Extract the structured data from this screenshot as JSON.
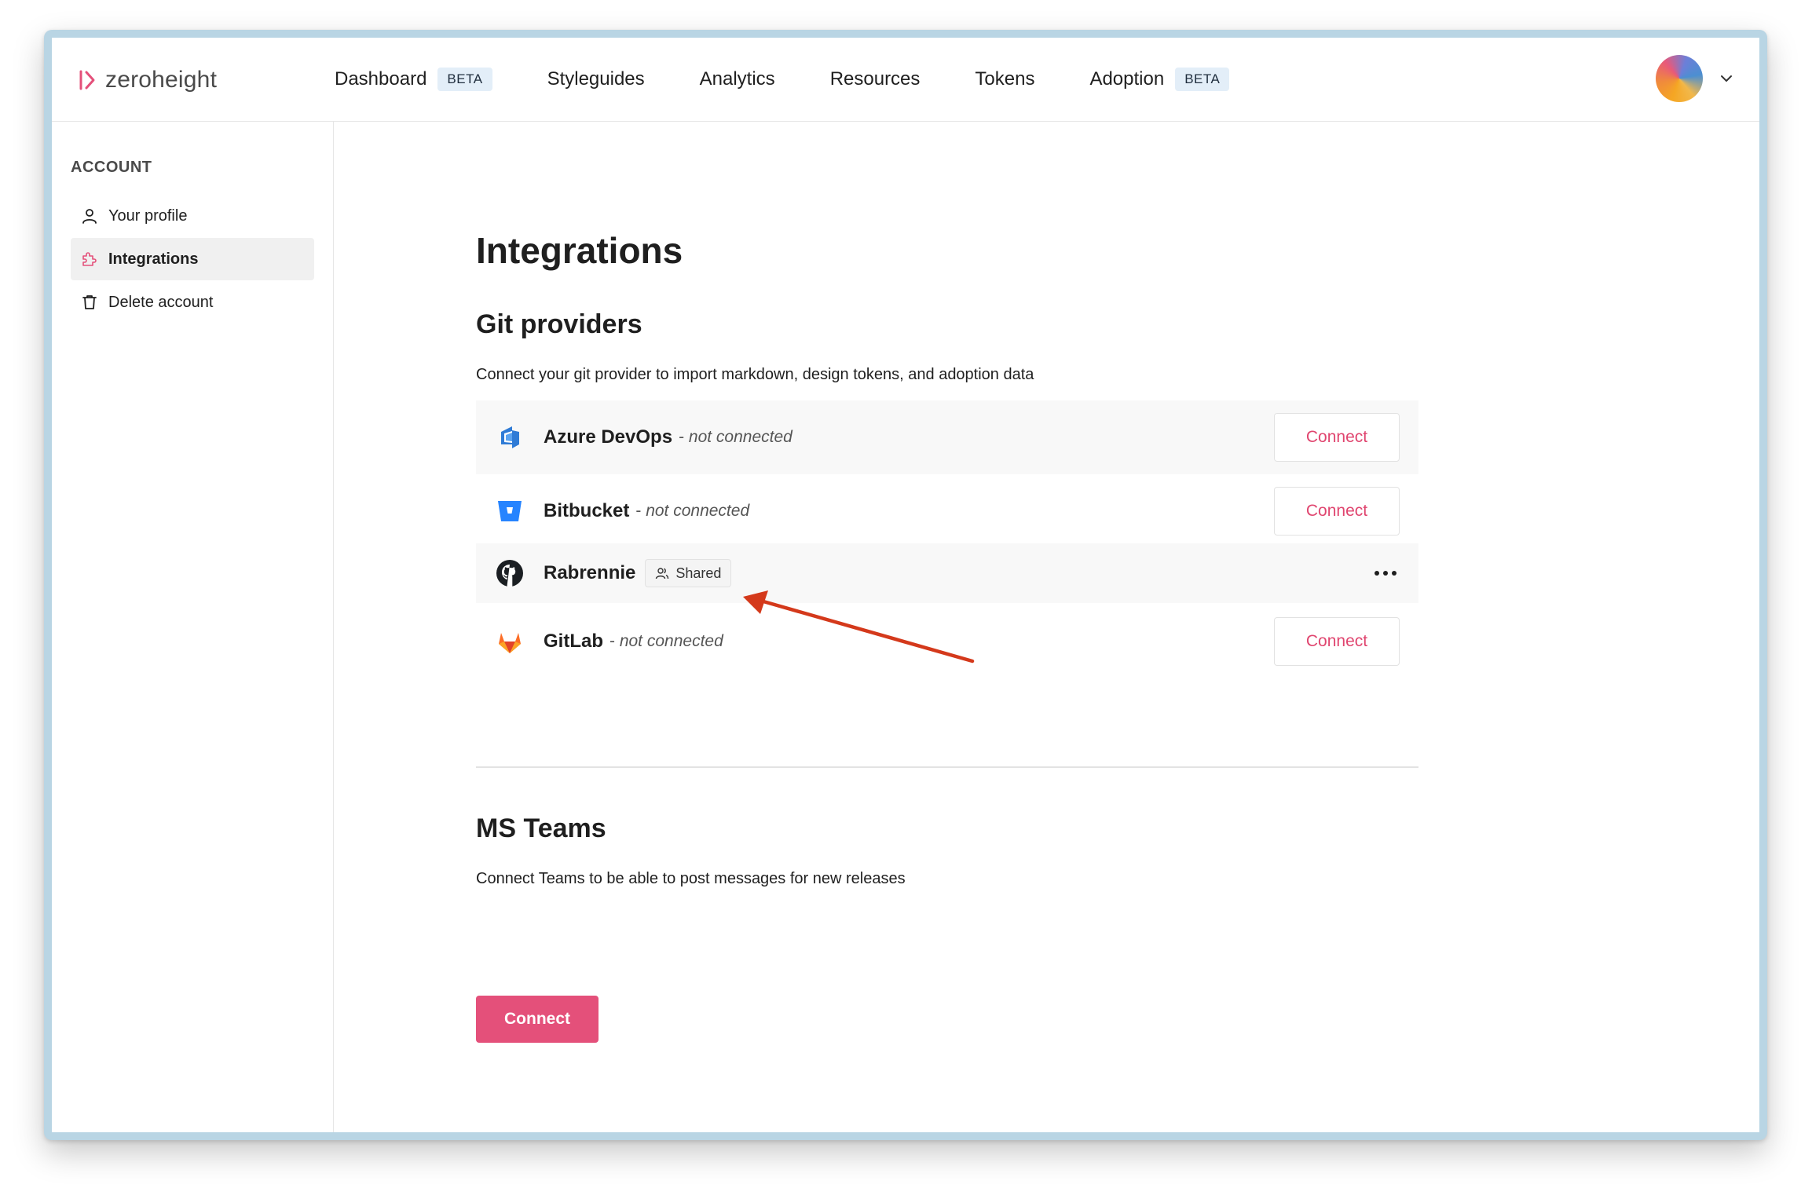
{
  "app": {
    "logo_text": "zeroheight"
  },
  "nav": {
    "items": [
      {
        "label": "Dashboard",
        "badge": "BETA"
      },
      {
        "label": "Styleguides"
      },
      {
        "label": "Analytics"
      },
      {
        "label": "Resources"
      },
      {
        "label": "Tokens"
      },
      {
        "label": "Adoption",
        "badge": "BETA"
      }
    ]
  },
  "sidebar": {
    "heading": "ACCOUNT",
    "items": [
      {
        "label": "Your profile",
        "icon": "user-icon"
      },
      {
        "label": "Integrations",
        "icon": "puzzle-icon",
        "active": true
      },
      {
        "label": "Delete account",
        "icon": "trash-icon"
      }
    ]
  },
  "main": {
    "title": "Integrations",
    "git": {
      "heading": "Git providers",
      "description": "Connect your git provider to import markdown, design tokens, and adoption data",
      "providers": [
        {
          "name": "Azure DevOps",
          "dash": " - ",
          "status": "not connected",
          "action": "Connect",
          "icon": "azure-devops-icon"
        },
        {
          "name": "Bitbucket",
          "dash": " - ",
          "status": "not connected",
          "action": "Connect",
          "icon": "bitbucket-icon"
        },
        {
          "name": "Rabrennie",
          "badge": "Shared",
          "icon": "github-icon",
          "menu": "more-options-icon"
        },
        {
          "name": "GitLab",
          "dash": " - ",
          "status": "not connected",
          "action": "Connect",
          "icon": "gitlab-icon"
        }
      ]
    },
    "teams": {
      "heading": "MS Teams",
      "description": "Connect Teams to be able to post messages for new releases",
      "button": "Connect"
    }
  },
  "colors": {
    "accent": "#e4507a",
    "annotation_arrow": "#d4391b",
    "badge_bg": "#e3eef8"
  }
}
